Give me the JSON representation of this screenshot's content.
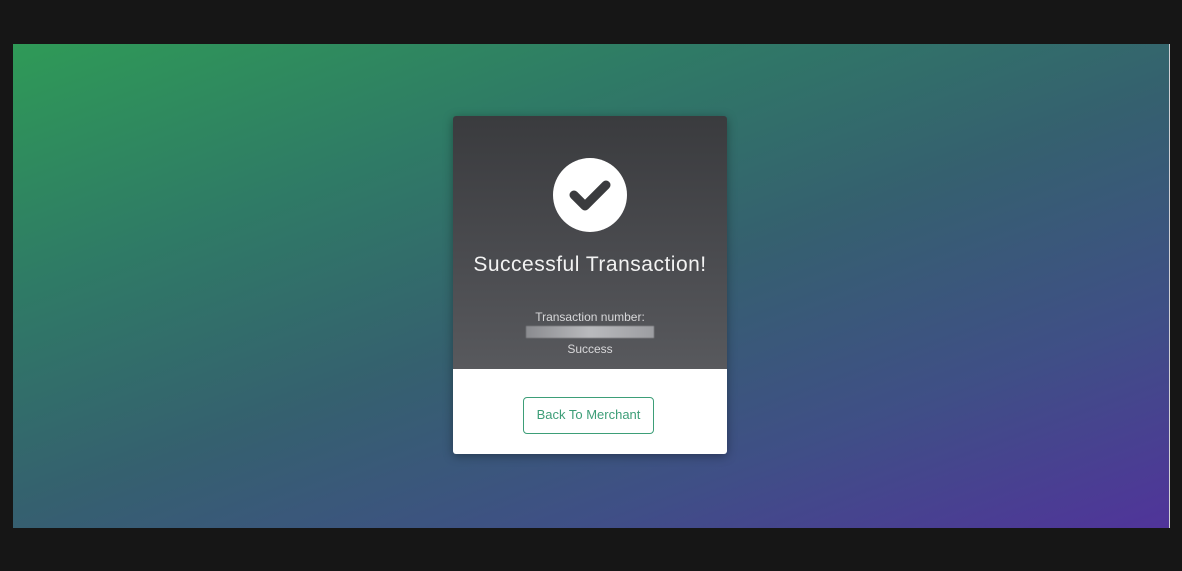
{
  "result": {
    "icon": "checkmark-circle-icon",
    "title": "Successful Transaction!",
    "transaction_label": "Transaction number:",
    "status": "Success"
  },
  "actions": {
    "back_label": "Back To Merchant"
  },
  "colors": {
    "accent": "#3d9e78",
    "card_dark": "#4a4b4f",
    "gradient_start": "#2f9a57",
    "gradient_end": "#50349a"
  }
}
